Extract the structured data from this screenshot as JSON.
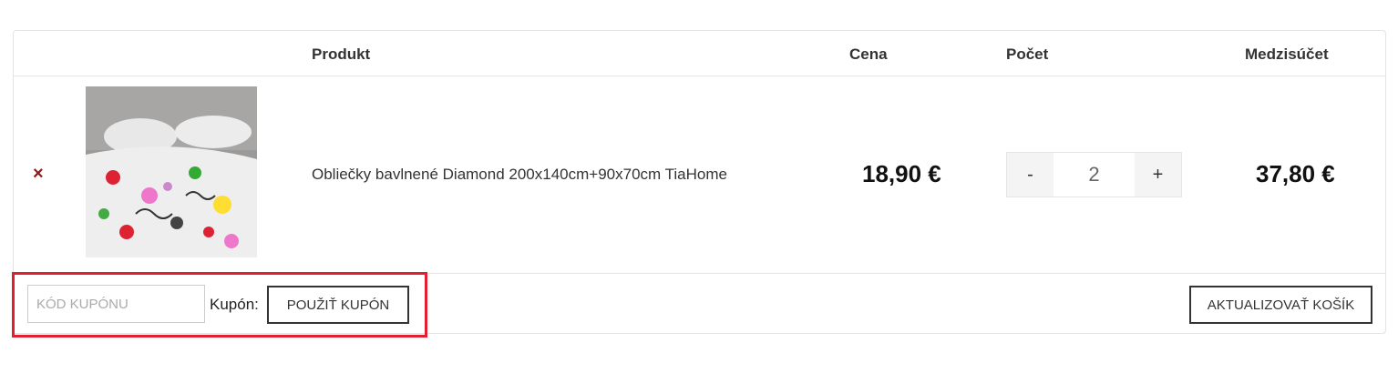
{
  "table": {
    "headers": {
      "product": "Produkt",
      "price": "Cena",
      "quantity": "Počet",
      "subtotal": "Medzisúčet"
    }
  },
  "item": {
    "remove_symbol": "×",
    "name": "Obliečky bavlnené Diamond 200x140cm+90x70cm TiaHome",
    "price": "18,90 €",
    "quantity": "2",
    "minus_label": "-",
    "plus_label": "+",
    "subtotal": "37,80 €"
  },
  "coupon": {
    "placeholder": "KÓD KUPÓNU",
    "label": "Kupón:",
    "apply_label": "POUŽIŤ KUPÓN"
  },
  "actions": {
    "update_label": "AKTUALIZOVAŤ KOŠÍK"
  },
  "colors": {
    "remove": "#8b1a1a",
    "highlight": "#e02030",
    "border": "#e4e4e4"
  }
}
